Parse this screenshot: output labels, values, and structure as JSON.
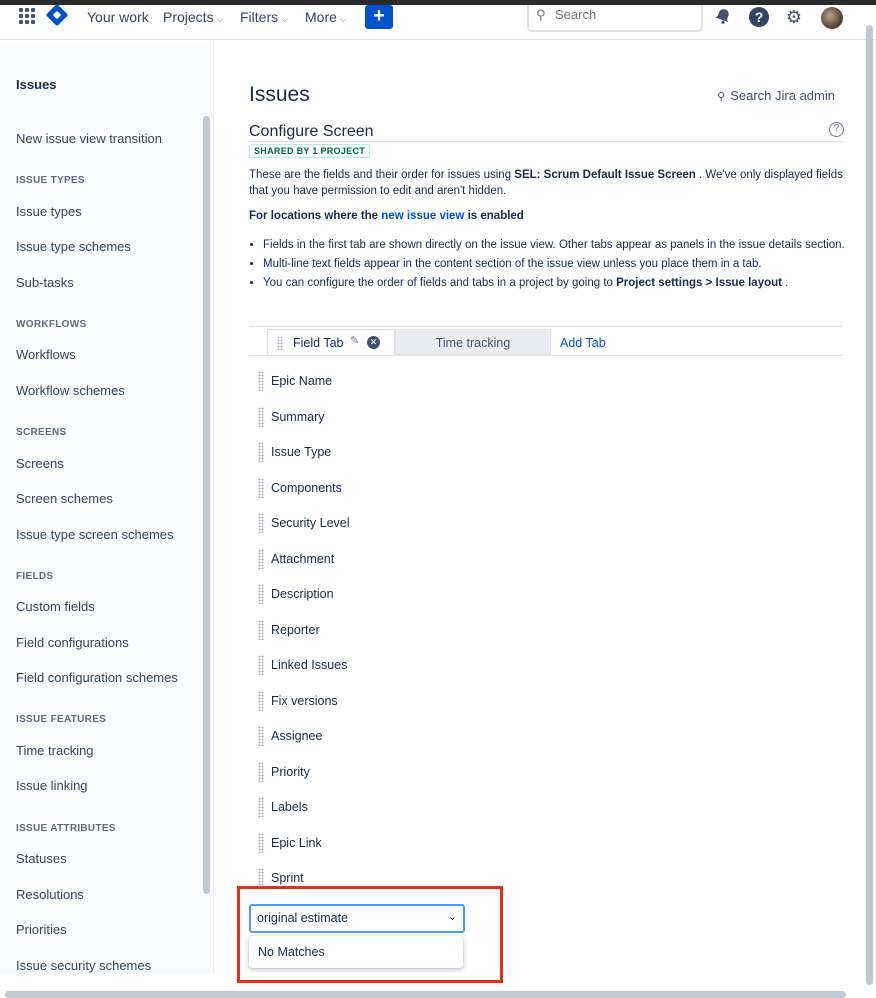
{
  "topbar": {
    "nav": [
      "Your work",
      "Projects",
      "Filters",
      "More"
    ],
    "search_placeholder": "Search",
    "help_glyph": "?"
  },
  "sidebar": {
    "title": "Issues",
    "top_item": "New issue view transition",
    "sections": [
      {
        "heading": "ISSUE TYPES",
        "items": [
          "Issue types",
          "Issue type schemes",
          "Sub-tasks"
        ]
      },
      {
        "heading": "WORKFLOWS",
        "items": [
          "Workflows",
          "Workflow schemes"
        ]
      },
      {
        "heading": "SCREENS",
        "items": [
          "Screens",
          "Screen schemes",
          "Issue type screen schemes"
        ]
      },
      {
        "heading": "FIELDS",
        "items": [
          "Custom fields",
          "Field configurations",
          "Field configuration schemes"
        ]
      },
      {
        "heading": "ISSUE FEATURES",
        "items": [
          "Time tracking",
          "Issue linking"
        ]
      },
      {
        "heading": "ISSUE ATTRIBUTES",
        "items": [
          "Statuses",
          "Resolutions",
          "Priorities",
          "Issue security schemes"
        ]
      }
    ]
  },
  "main": {
    "page_title": "Issues",
    "admin_search": "Search Jira admin",
    "configure_title": "Configure Screen",
    "shared_badge": "SHARED BY 1 PROJECT",
    "desc_prefix": "These are the fields and their order for issues using ",
    "desc_screen": "SEL: Scrum Default Issue Screen",
    "desc_suffix": " . We've only displayed fields that you have permission to edit and aren't hidden.",
    "loc_prefix": "For locations where the ",
    "loc_link": "new issue view",
    "loc_suffix": " is enabled",
    "bullets": [
      "Fields in the first tab are shown directly on the issue view. Other tabs appear as panels in the issue details section.",
      "Multi-line text fields appear in the content section of the issue view unless you place them in a tab."
    ],
    "bullet3_prefix": "You can configure the order of fields and tabs in a project by going to ",
    "bullet3_bold": "Project settings > Issue layout",
    "bullet3_suffix": " .",
    "tabs": {
      "field_tab": "Field Tab",
      "time_tracking": "Time tracking",
      "add_tab": "Add Tab"
    },
    "fields": [
      "Epic Name",
      "Summary",
      "Issue Type",
      "Components",
      "Security Level",
      "Attachment",
      "Description",
      "Reporter",
      "Linked Issues",
      "Fix versions",
      "Assignee",
      "Priority",
      "Labels",
      "Epic Link",
      "Sprint"
    ],
    "add_field_value": "original estimate",
    "no_matches": "No Matches"
  },
  "colors": {
    "accent": "#0052cc",
    "highlight": "#ee2a1b",
    "badge": "#006644"
  }
}
